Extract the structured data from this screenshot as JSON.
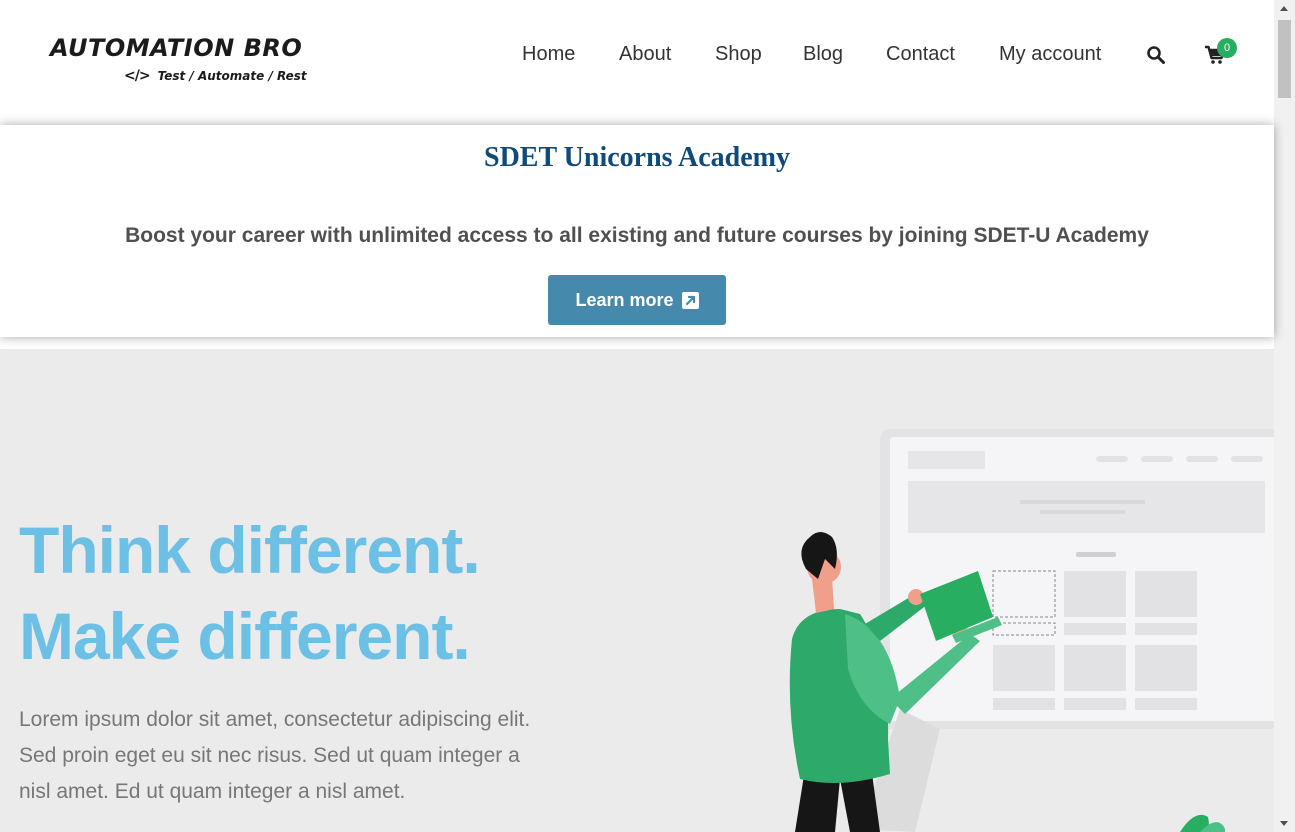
{
  "header": {
    "logo_title": "AUTOMATION BRO",
    "logo_code": "</>",
    "logo_tagline": "Test / Automate / Rest",
    "nav": [
      {
        "label": "Home"
      },
      {
        "label": "About"
      },
      {
        "label": "Shop"
      },
      {
        "label": "Blog"
      },
      {
        "label": "Contact"
      },
      {
        "label": "My account"
      }
    ],
    "search_icon": "search-icon",
    "cart_icon": "cart-icon",
    "cart_count": "0"
  },
  "promo": {
    "title": "SDET Unicorns Academy",
    "text": "Boost your career with unlimited access to all existing and future courses by joining SDET-U Academy",
    "button_label": "Learn more",
    "button_icon": "external-link-icon"
  },
  "hero": {
    "headline_line1": "Think different.",
    "headline_line2": "Make different.",
    "paragraph": "Lorem ipsum dolor sit amet, consectetur adipiscing elit. Sed proin eget eu sit nec risus. Sed ut quam integer a nisl amet.  Ed ut quam integer a nisl amet."
  },
  "colors": {
    "accent_blue": "#6dc0e5",
    "button_blue": "#4589ad",
    "promo_title": "#0f4a7a",
    "badge_green": "#27ae60",
    "hero_bg": "#ebebeb"
  }
}
